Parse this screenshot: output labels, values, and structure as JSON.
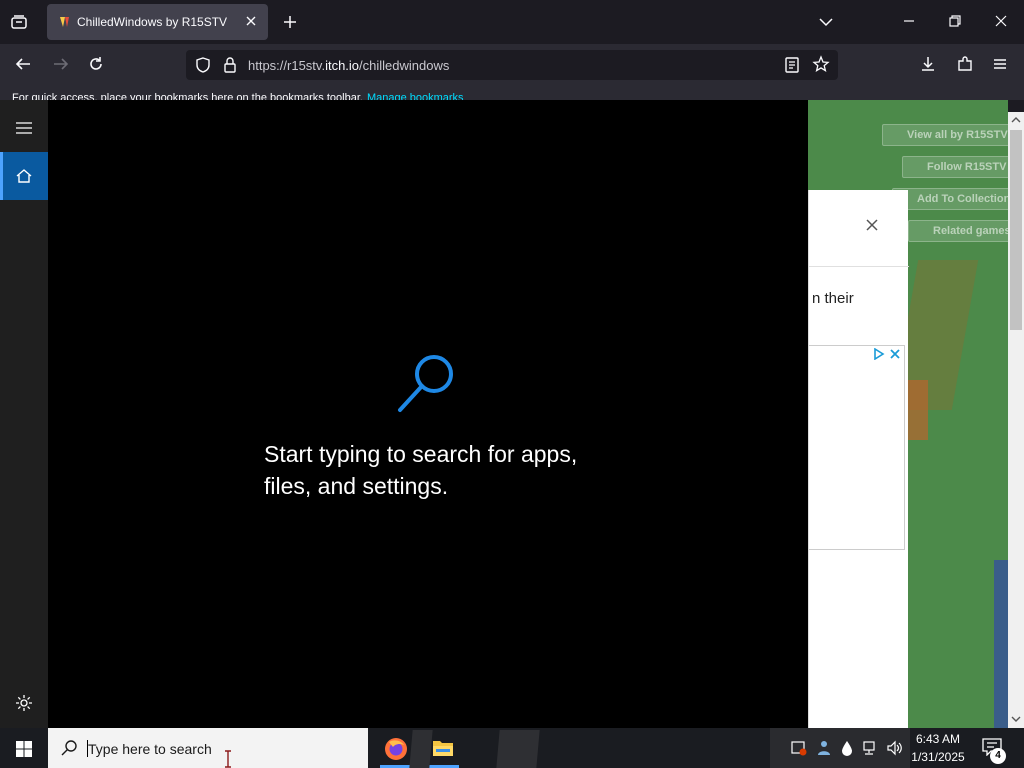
{
  "browser": {
    "tab_title": "ChilledWindows by R15STV",
    "url_prefix": "https://r15stv.",
    "url_host": "itch.io",
    "url_path": "/chilledwindows",
    "bookmarks_text": "For quick access, place your bookmarks here on the bookmarks toolbar.",
    "bookmarks_link": "Manage bookmarks"
  },
  "page": {
    "buttons": [
      "View all by R15STV",
      "Follow R15STV",
      "Add To Collection",
      "Related games"
    ],
    "modal_text": "n their"
  },
  "start_menu": {
    "search_hint": "Start typing to search for apps, files, and settings."
  },
  "taskbar": {
    "search_placeholder": "Type here to search",
    "time": "6:43 AM",
    "date": "1/31/2025",
    "notification_count": "4"
  },
  "colors": {
    "accent": "#0a5aa0",
    "search_icon": "#1e88e5",
    "page_bg": "#4c8a4a"
  }
}
